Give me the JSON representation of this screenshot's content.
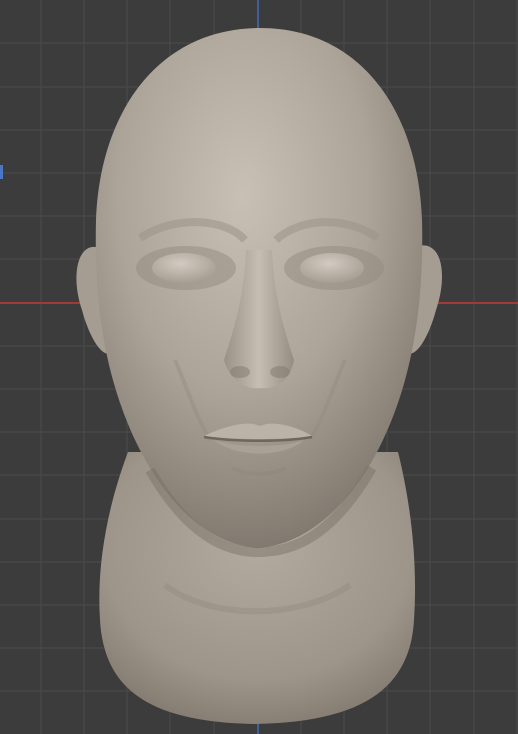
{
  "viewport": {
    "background_color": "#3c3c3c",
    "grid_line_color": "#4b4b4b",
    "axis_x_color": "#a23a3a",
    "axis_y_color": "#3f5f9e"
  },
  "model": {
    "name": "sculpted head",
    "clay_color": "#b3aba1"
  }
}
